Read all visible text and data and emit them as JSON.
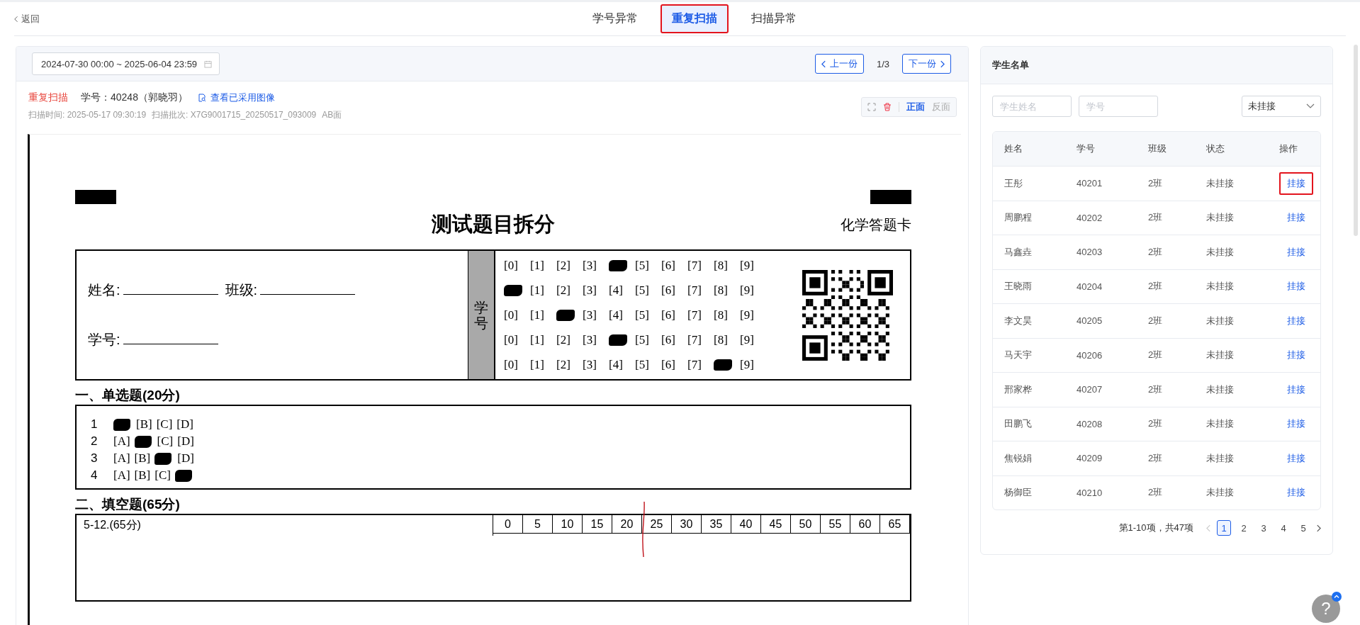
{
  "top_bar": {
    "back_link": "返回",
    "tabs": [
      {
        "label": "学号异常",
        "selected": false,
        "highlighted": false
      },
      {
        "label": "重复扫描",
        "selected": true,
        "highlighted": true
      },
      {
        "label": "扫描异常",
        "selected": false,
        "highlighted": false
      }
    ]
  },
  "review": {
    "date_range": "2024-07-30 00:00 ~ 2025-06-04 23:59",
    "prev_button": "上一份",
    "page_indicator": "1/3",
    "next_button": "下一份",
    "status": "重复扫描",
    "student": "学号：40248（郭晓羽）",
    "view_link": "查看已采用图像",
    "scan_time": "扫描时间: 2025-05-17 09:30:19",
    "scan_batch": "扫描批次: X7G9001715_20250517_093009",
    "side_info": "AB面",
    "faces": [
      {
        "label": "正面",
        "selected": true
      },
      {
        "label": "反面",
        "selected": false
      }
    ]
  },
  "answer_sheet": {
    "title": "测试题目拆分",
    "subject": "化学答题卡",
    "name_label": "姓名:",
    "class_label": "班级:",
    "id_label": "学号:",
    "id_column_label": "学号",
    "id_bubbles": [
      [
        {
          "label": "[0]",
          "filled": false
        },
        {
          "label": "[1]",
          "filled": false
        },
        {
          "label": "[2]",
          "filled": false
        },
        {
          "label": "[3]",
          "filled": false
        },
        {
          "filled": true
        },
        {
          "label": "[5]",
          "filled": false
        },
        {
          "label": "[6]",
          "filled": false
        },
        {
          "label": "[7]",
          "filled": false
        },
        {
          "label": "[8]",
          "filled": false
        },
        {
          "label": "[9]",
          "filled": false
        }
      ],
      [
        {
          "filled": true
        },
        {
          "label": "[1]",
          "filled": false
        },
        {
          "label": "[2]",
          "filled": false
        },
        {
          "label": "[3]",
          "filled": false
        },
        {
          "label": "[4]",
          "filled": false
        },
        {
          "label": "[5]",
          "filled": false
        },
        {
          "label": "[6]",
          "filled": false
        },
        {
          "label": "[7]",
          "filled": false
        },
        {
          "label": "[8]",
          "filled": false
        },
        {
          "label": "[9]",
          "filled": false
        }
      ],
      [
        {
          "label": "[0]",
          "filled": false
        },
        {
          "label": "[1]",
          "filled": false
        },
        {
          "filled": true
        },
        {
          "label": "[3]",
          "filled": false
        },
        {
          "label": "[4]",
          "filled": false
        },
        {
          "label": "[5]",
          "filled": false
        },
        {
          "label": "[6]",
          "filled": false
        },
        {
          "label": "[7]",
          "filled": false
        },
        {
          "label": "[8]",
          "filled": false
        },
        {
          "label": "[9]",
          "filled": false
        }
      ],
      [
        {
          "label": "[0]",
          "filled": false
        },
        {
          "label": "[1]",
          "filled": false
        },
        {
          "label": "[2]",
          "filled": false
        },
        {
          "label": "[3]",
          "filled": false
        },
        {
          "filled": true
        },
        {
          "label": "[5]",
          "filled": false
        },
        {
          "label": "[6]",
          "filled": false
        },
        {
          "label": "[7]",
          "filled": false
        },
        {
          "label": "[8]",
          "filled": false
        },
        {
          "label": "[9]",
          "filled": false
        }
      ],
      [
        {
          "label": "[0]",
          "filled": false
        },
        {
          "label": "[1]",
          "filled": false
        },
        {
          "label": "[2]",
          "filled": false
        },
        {
          "label": "[3]",
          "filled": false
        },
        {
          "label": "[4]",
          "filled": false
        },
        {
          "label": "[5]",
          "filled": false
        },
        {
          "label": "[6]",
          "filled": false
        },
        {
          "label": "[7]",
          "filled": false
        },
        {
          "filled": true
        },
        {
          "label": "[9]",
          "filled": false
        }
      ]
    ],
    "section_1": {
      "heading": "一、单选题(20分)",
      "questions": [
        {
          "number": "1",
          "options": [
            {
              "filled": true
            },
            {
              "label": "[B]",
              "filled": false
            },
            {
              "label": "[C]",
              "filled": false
            },
            {
              "label": "[D]",
              "filled": false
            }
          ]
        },
        {
          "number": "2",
          "options": [
            {
              "label": "[A]",
              "filled": false
            },
            {
              "filled": true
            },
            {
              "label": "[C]",
              "filled": false
            },
            {
              "label": "[D]",
              "filled": false
            }
          ]
        },
        {
          "number": "3",
          "options": [
            {
              "label": "[A]",
              "filled": false
            },
            {
              "label": "[B]",
              "filled": false
            },
            {
              "filled": true
            },
            {
              "label": "[D]",
              "filled": false
            }
          ]
        },
        {
          "number": "4",
          "options": [
            {
              "label": "[A]",
              "filled": false
            },
            {
              "label": "[B]",
              "filled": false
            },
            {
              "label": "[C]",
              "filled": false
            },
            {
              "filled": true
            }
          ]
        }
      ]
    },
    "section_2": {
      "heading": "二、填空题(65分)",
      "item": "5-12.(65分)",
      "scores": [
        "0",
        "5",
        "10",
        "15",
        "20",
        "25",
        "30",
        "35",
        "40",
        "45",
        "50",
        "55",
        "60",
        "65"
      ]
    }
  },
  "student_list": {
    "title": "学生名单",
    "name_search": {
      "placeholder": "学生姓名"
    },
    "id_search": {
      "placeholder": "学号"
    },
    "status_filter": "未挂接",
    "columns": [
      "姓名",
      "学号",
      "班级",
      "状态",
      "操作"
    ],
    "rows": [
      {
        "name": "王彤",
        "id": "40201",
        "class": "2班",
        "status": "未挂接",
        "action": "挂接",
        "highlighted": true
      },
      {
        "name": "周鹏程",
        "id": "40202",
        "class": "2班",
        "status": "未挂接",
        "action": "挂接",
        "highlighted": false
      },
      {
        "name": "马鑫垚",
        "id": "40203",
        "class": "2班",
        "status": "未挂接",
        "action": "挂接",
        "highlighted": false
      },
      {
        "name": "王晓雨",
        "id": "40204",
        "class": "2班",
        "status": "未挂接",
        "action": "挂接",
        "highlighted": false
      },
      {
        "name": "李文昊",
        "id": "40205",
        "class": "2班",
        "status": "未挂接",
        "action": "挂接",
        "highlighted": false
      },
      {
        "name": "马天宇",
        "id": "40206",
        "class": "2班",
        "status": "未挂接",
        "action": "挂接",
        "highlighted": false
      },
      {
        "name": "邢家桦",
        "id": "40207",
        "class": "2班",
        "status": "未挂接",
        "action": "挂接",
        "highlighted": false
      },
      {
        "name": "田鹏飞",
        "id": "40208",
        "class": "2班",
        "status": "未挂接",
        "action": "挂接",
        "highlighted": false
      },
      {
        "name": "焦锐娟",
        "id": "40209",
        "class": "2班",
        "status": "未挂接",
        "action": "挂接",
        "highlighted": false
      },
      {
        "name": "杨御臣",
        "id": "40210",
        "class": "2班",
        "status": "未挂接",
        "action": "挂接",
        "highlighted": false
      }
    ],
    "pagination": {
      "summary": "第1-10项，共47项",
      "pages": [
        {
          "label": "1",
          "selected": true
        },
        {
          "label": "2",
          "selected": false
        },
        {
          "label": "3",
          "selected": false
        },
        {
          "label": "4",
          "selected": false
        },
        {
          "label": "5",
          "selected": false
        }
      ]
    }
  },
  "help_button": "?"
}
